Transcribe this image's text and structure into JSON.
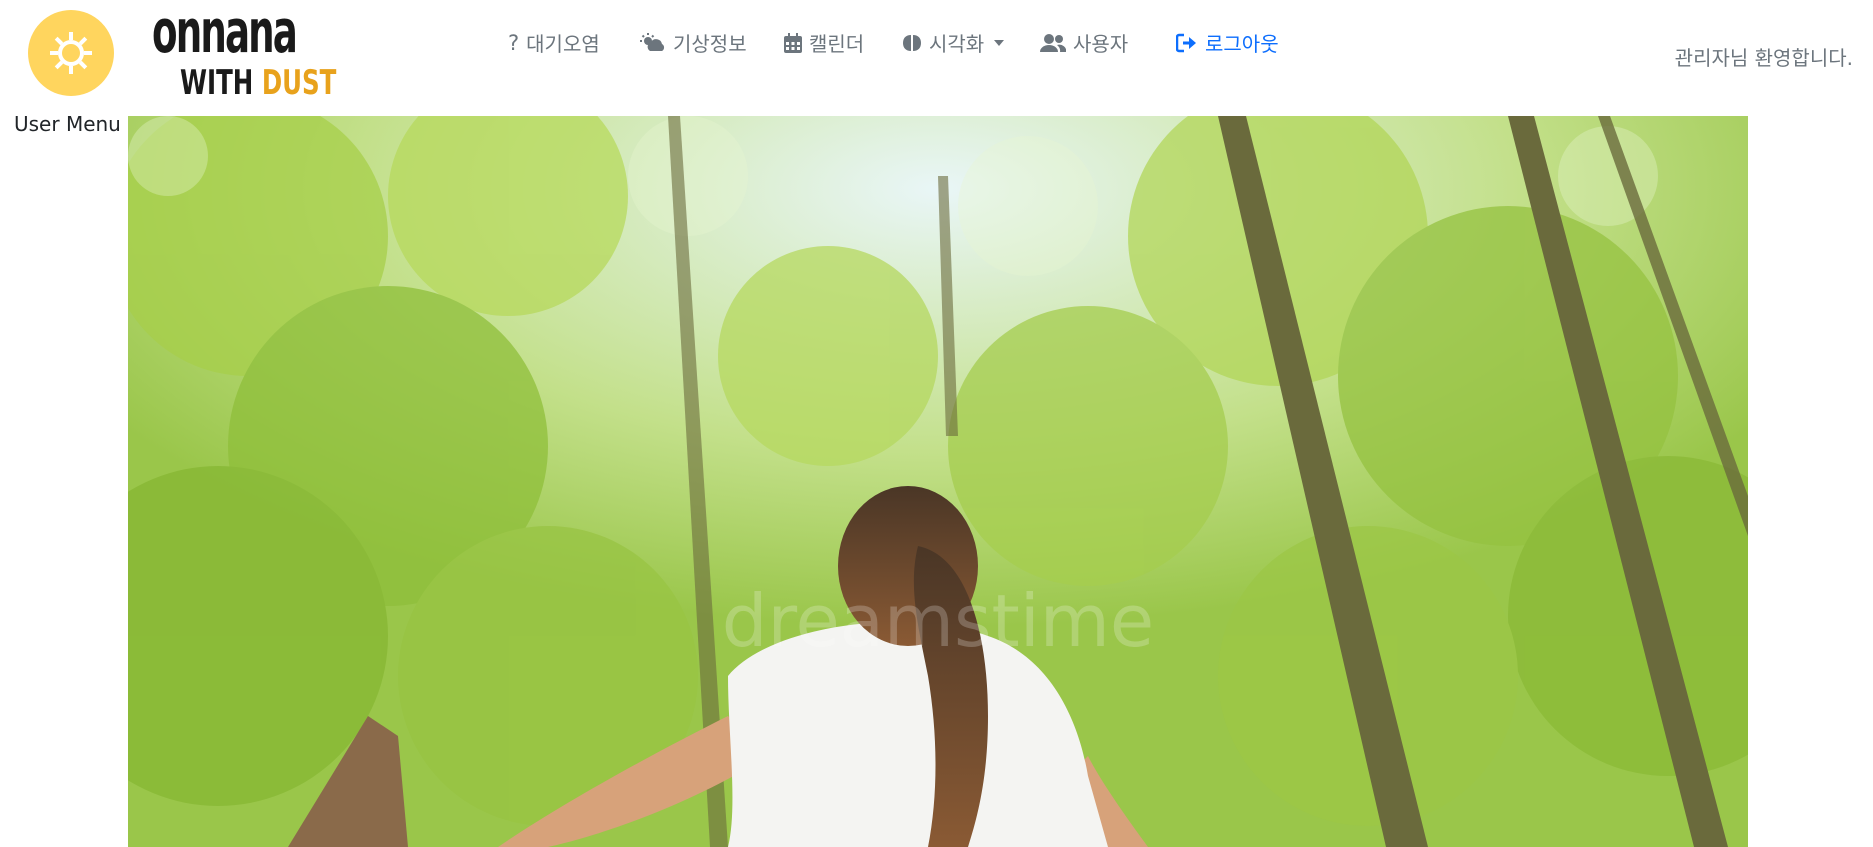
{
  "header": {
    "user_menu": {
      "icon": "sun-icon",
      "label": "User Menu"
    },
    "brand": {
      "line1": "onnana",
      "line2_a": "WITH",
      "line2_b": "DUST",
      "colors": {
        "dark": "#1a1a1a",
        "accent": "#e8a21c"
      }
    },
    "nav": [
      {
        "label": "대기오염",
        "icon": "question-icon"
      },
      {
        "label": "기상정보",
        "icon": "cloud-sun-icon"
      },
      {
        "label": "캘린더",
        "icon": "calendar-icon"
      },
      {
        "label": "시각화",
        "icon": "brain-icon",
        "dropdown": true
      },
      {
        "label": "사용자",
        "icon": "users-icon"
      },
      {
        "label": "로그아웃",
        "icon": "sign-out-icon"
      }
    ],
    "welcome": "관리자님 환영합니다."
  },
  "hero": {
    "image": "forest-woman-breathing-photo",
    "watermark": "dreamstime"
  },
  "colors": {
    "nav_text": "#6c757d",
    "logout": "#0d6efd",
    "user_menu_bg": "#ffd55e"
  }
}
